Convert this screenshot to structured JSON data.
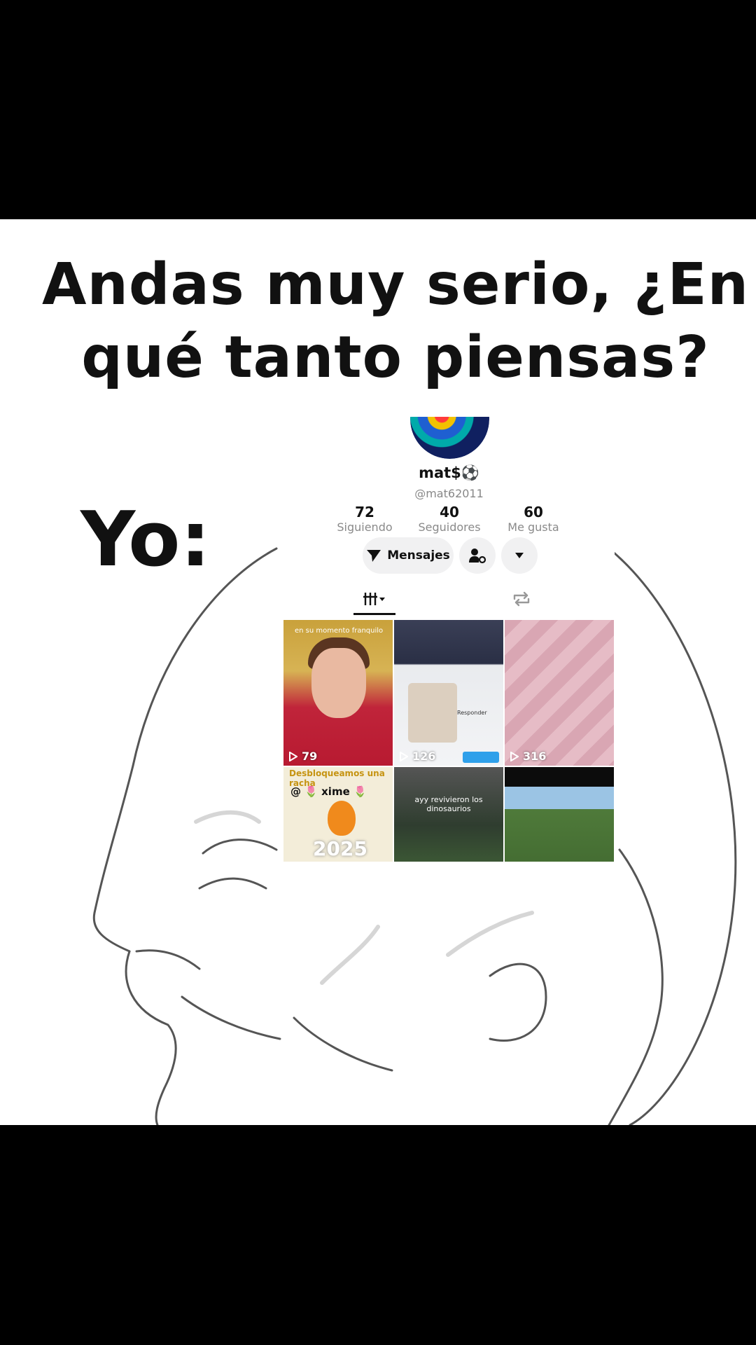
{
  "meme": {
    "caption": "Andas muy serio, ¿En qué tanto piensas?",
    "yo_label": "Yo:"
  },
  "profile": {
    "display_name": "mat$⚽",
    "username": "@mat62011",
    "stats": [
      {
        "value": "72",
        "label": "Siguiendo"
      },
      {
        "value": "40",
        "label": "Seguidores"
      },
      {
        "value": "60",
        "label": "Me gusta"
      }
    ],
    "message_button": "Mensajes",
    "videos": [
      {
        "views": "79",
        "overlay_text": "en su momento franquilo"
      },
      {
        "views": "126",
        "overlay_text": "Responder"
      },
      {
        "views": "316",
        "overlay_text": ""
      },
      {
        "views": "",
        "overlay_title": "Desbloqueamos una racha",
        "overlay_name": "@ 🌷 xime 🌷",
        "overlay_year": "2025"
      },
      {
        "views": "",
        "overlay_text": "ayy revivieron los dinosaurios"
      },
      {
        "views": "",
        "overlay_text": ""
      }
    ]
  },
  "colors": {
    "accent": "#111111",
    "muted": "#8a8a8a",
    "button_bg": "#f1f1f2"
  }
}
